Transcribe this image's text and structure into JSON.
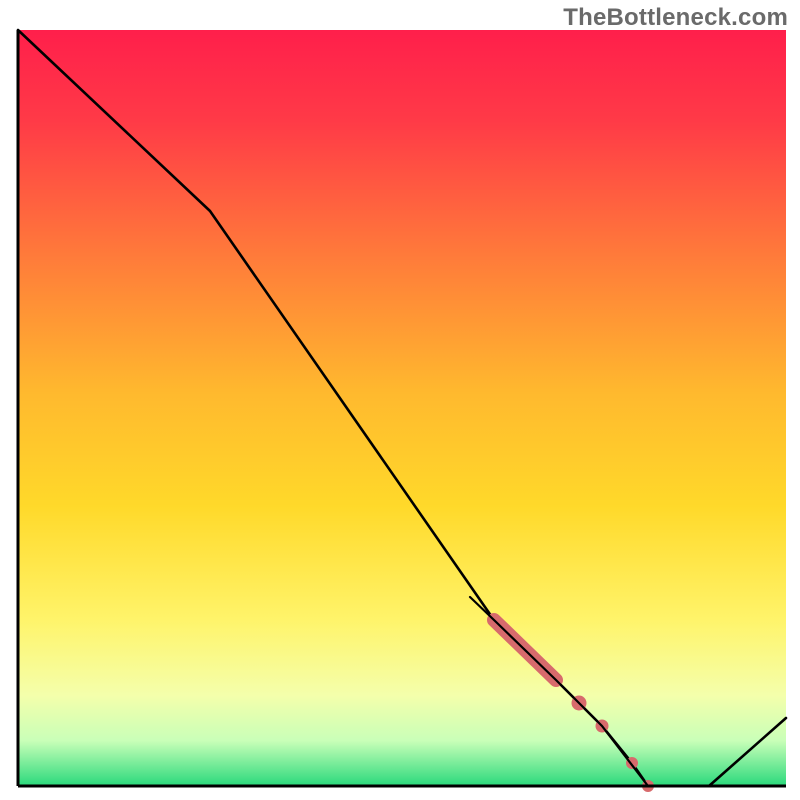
{
  "watermark": {
    "text": "TheBottleneck.com"
  },
  "chart_data": {
    "type": "line",
    "title": "",
    "xlabel": "",
    "ylabel": "",
    "xlim": [
      0,
      100
    ],
    "ylim": [
      0,
      100
    ],
    "series": [
      {
        "name": "curve",
        "x": [
          0,
          25,
          62,
          66,
          70,
          73,
          76,
          80,
          82,
          90,
          100
        ],
        "y": [
          100,
          76,
          22,
          18,
          14,
          11,
          8,
          3,
          0,
          0,
          9
        ]
      }
    ],
    "markers": [
      {
        "name": "thick-segment",
        "x_start": 62,
        "x_end": 70,
        "note": "emphasized stroke on curve"
      },
      {
        "name": "dot-1",
        "x": 73
      },
      {
        "name": "dot-2",
        "x": 76
      },
      {
        "name": "dot-3",
        "x": 80
      },
      {
        "name": "dot-4",
        "x": 82
      }
    ],
    "colors": {
      "gradient_top": "#ff1f4b",
      "gradient_mid": "#ffd400",
      "gradient_lower": "#f7ff9e",
      "gradient_bottom": "#2ad97c",
      "line": "#000000",
      "marker": "#d76a6c",
      "border": "#000000"
    }
  }
}
